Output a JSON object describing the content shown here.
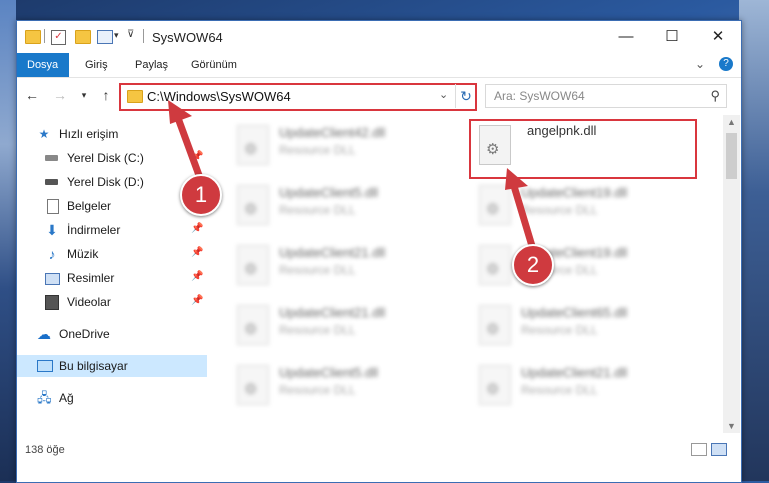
{
  "window": {
    "title": "SysWOW64",
    "minimize_glyph": "—",
    "maximize_glyph": "☐",
    "close_glyph": "✕"
  },
  "ribbon": {
    "tabs": [
      "Dosya",
      "Giriş",
      "Paylaş",
      "Görünüm"
    ],
    "active_tab": "Dosya",
    "expand_glyph": "⌄",
    "help_glyph": "?"
  },
  "address": {
    "path": "C:\\Windows\\SysWOW64",
    "search_placeholder": "Ara: SysWOW64"
  },
  "nav": {
    "quick_access": "Hızlı erişim",
    "items": [
      {
        "label": "Yerel Disk (C:)",
        "icon": "drive-icon",
        "pinned": true
      },
      {
        "label": "Yerel Disk (D:)",
        "icon": "drive-icon",
        "pinned": false
      },
      {
        "label": "Belgeler",
        "icon": "documents-icon",
        "pinned": false
      },
      {
        "label": "İndirmeler",
        "icon": "download-icon",
        "pinned": true
      },
      {
        "label": "Müzik",
        "icon": "music-icon",
        "pinned": true
      },
      {
        "label": "Resimler",
        "icon": "pictures-icon",
        "pinned": true
      },
      {
        "label": "Videolar",
        "icon": "videos-icon",
        "pinned": true
      }
    ],
    "onedrive": "OneDrive",
    "this_pc": "Bu bilgisayar",
    "network": "Ağ"
  },
  "files": [
    {
      "name": "UpdateClient42.dll",
      "type": "Resource DLL",
      "blurred": true
    },
    {
      "name": "angelpnk.dll",
      "type": "",
      "blurred": false
    },
    {
      "name": "UpdateClient5.dll",
      "type": "Resource DLL",
      "blurred": true
    },
    {
      "name": "UpdateClient19.dll",
      "type": "Resource DLL",
      "blurred": true
    },
    {
      "name": "UpdateClient21.dll",
      "type": "Resource DLL",
      "blurred": true
    },
    {
      "name": "UpdateClient19.dll",
      "type": "Resource DLL",
      "blurred": true
    },
    {
      "name": "UpdateClient21.dll",
      "type": "Resource DLL",
      "blurred": true
    },
    {
      "name": "UpdateClient65.dll",
      "type": "Resource DLL",
      "blurred": true
    },
    {
      "name": "UpdateClient5.dll",
      "type": "Resource DLL",
      "blurred": true
    },
    {
      "name": "UpdateClient21.dll",
      "type": "Resource DLL",
      "blurred": true
    }
  ],
  "status": {
    "item_count": "138 öğe"
  },
  "annotations": {
    "step1": "1",
    "step2": "2",
    "color": "#cf3a3f"
  }
}
